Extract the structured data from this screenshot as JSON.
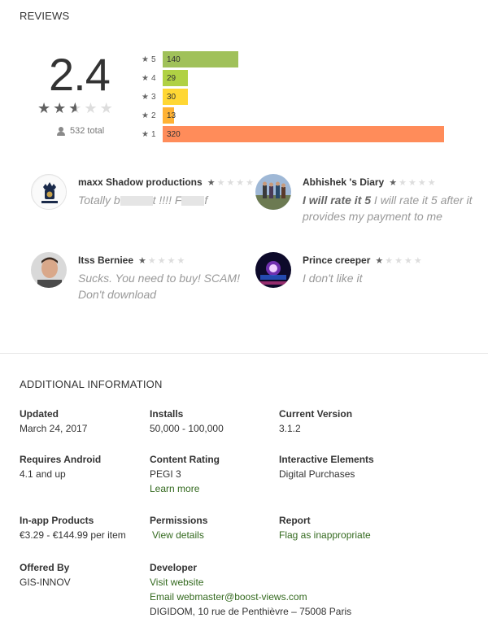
{
  "reviews_heading": "REVIEWS",
  "rating": {
    "score": "2.4",
    "stars": 2.5,
    "total": "532 total",
    "histogram": [
      {
        "label": "5",
        "count": "140",
        "fraction": 0.27,
        "color": "#a0c15a"
      },
      {
        "label": "4",
        "count": "29",
        "fraction": 0.09,
        "color": "#b0d144"
      },
      {
        "label": "3",
        "count": "30",
        "fraction": 0.09,
        "color": "#ffd734"
      },
      {
        "label": "2",
        "count": "13",
        "fraction": 0.04,
        "color": "#ffb234"
      },
      {
        "label": "1",
        "count": "320",
        "fraction": 1.0,
        "color": "#ff8c5a"
      }
    ]
  },
  "reviews": [
    {
      "author": "maxx Shadow productions",
      "rating": 1,
      "text_parts": [
        "Totally b",
        "t !!!! F",
        "f"
      ],
      "avatar": "kingdom-logo"
    },
    {
      "author": "Abhishek 's Diary",
      "rating": 1,
      "title": "I will rate it 5",
      "text": "I will rate it 5 after it provides my payment to me",
      "avatar": "group-photo"
    },
    {
      "author": "Itss Berniee",
      "rating": 1,
      "text": "Sucks. You need to buy! SCAM! Don't download",
      "avatar": "man-photo"
    },
    {
      "author": "Prince creeper",
      "rating": 1,
      "text": "I don't like it",
      "avatar": "neon-photo"
    }
  ],
  "additional_info": {
    "heading": "ADDITIONAL INFORMATION",
    "updated": {
      "title": "Updated",
      "value": "March 24, 2017"
    },
    "installs": {
      "title": "Installs",
      "value": "50,000 - 100,000"
    },
    "version": {
      "title": "Current Version",
      "value": "3.1.2"
    },
    "requires": {
      "title": "Requires Android",
      "value": "4.1 and up"
    },
    "content_rating": {
      "title": "Content Rating",
      "value": "PEGI 3",
      "link": "Learn more"
    },
    "interactive": {
      "title": "Interactive Elements",
      "value": "Digital Purchases"
    },
    "iap": {
      "title": "In-app Products",
      "value": "€3.29 - €144.99 per item"
    },
    "permissions": {
      "title": "Permissions",
      "link": "View details"
    },
    "report": {
      "title": "Report",
      "link": "Flag as inappropriate"
    },
    "offered_by": {
      "title": "Offered By",
      "value": "GIS-INNOV"
    },
    "developer": {
      "title": "Developer",
      "website": "Visit website",
      "email": "Email webmaster@boost-views.com",
      "address": "DIGIDOM, 10 rue de Penthièvre – 75008 Paris"
    }
  },
  "colors": {
    "link": "#33691e",
    "star_active": "#616161",
    "star_inactive": "#dddddd"
  }
}
